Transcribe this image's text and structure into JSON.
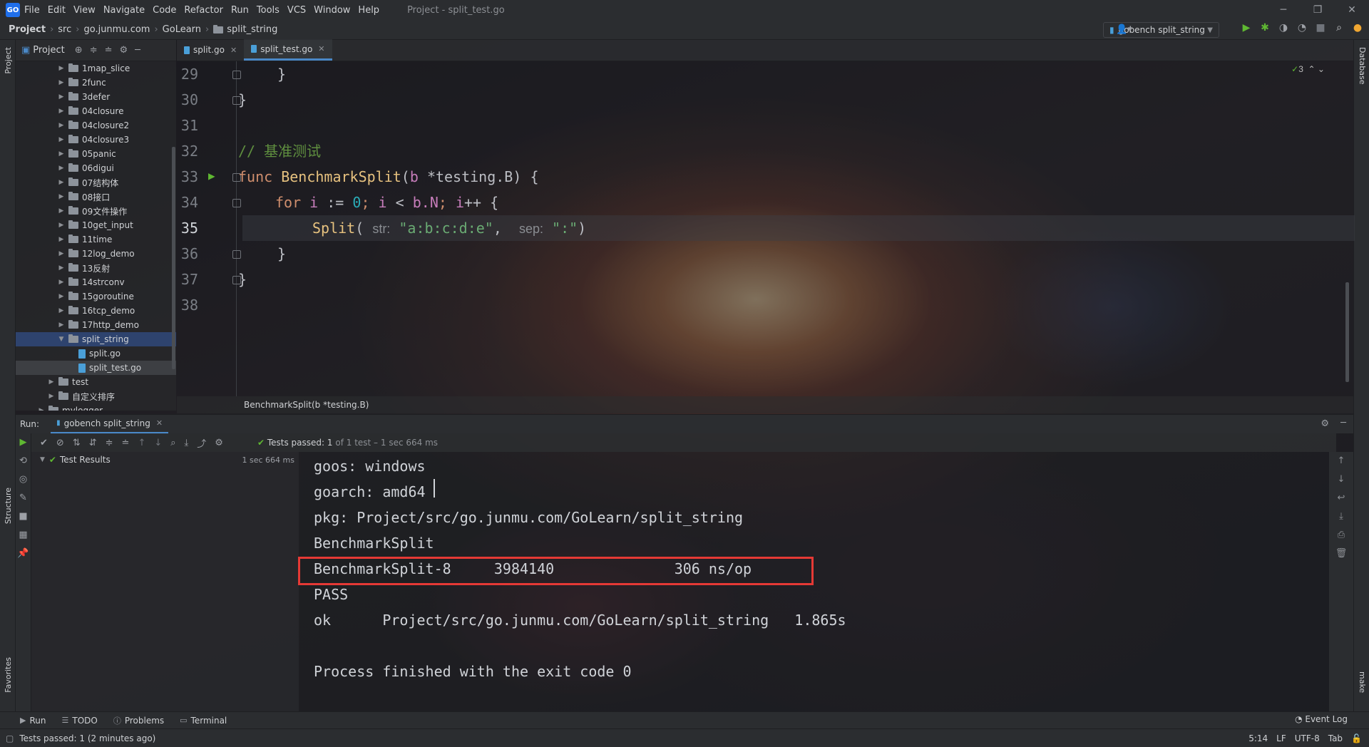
{
  "window": {
    "app_logo": "GO",
    "menu": [
      "File",
      "Edit",
      "View",
      "Navigate",
      "Code",
      "Refactor",
      "Run",
      "Tools",
      "VCS",
      "Window",
      "Help"
    ],
    "title": "Project - split_test.go"
  },
  "nav": {
    "breadcrumbs": [
      "Project",
      "src",
      "go.junmu.com",
      "GoLearn",
      "split_string"
    ],
    "run_config": "gobench split_string"
  },
  "left_stripe": {
    "project": "Project",
    "structure": "Structure",
    "favorites": "Favorites"
  },
  "right_stripe": {
    "database": "Database",
    "make": "make"
  },
  "project_panel": {
    "header": "Project",
    "items": [
      {
        "label": "1map_slice",
        "type": "folder",
        "depth": 4
      },
      {
        "label": "2func",
        "type": "folder",
        "depth": 4
      },
      {
        "label": "3defer",
        "type": "folder",
        "depth": 4
      },
      {
        "label": "04closure",
        "type": "folder",
        "depth": 4
      },
      {
        "label": "04closure2",
        "type": "folder",
        "depth": 4
      },
      {
        "label": "04closure3",
        "type": "folder",
        "depth": 4
      },
      {
        "label": "05panic",
        "type": "folder",
        "depth": 4
      },
      {
        "label": "06digui",
        "type": "folder",
        "depth": 4
      },
      {
        "label": "07结构体",
        "type": "folder",
        "depth": 4
      },
      {
        "label": "08接口",
        "type": "folder",
        "depth": 4
      },
      {
        "label": "09文件操作",
        "type": "folder",
        "depth": 4
      },
      {
        "label": "10get_input",
        "type": "folder",
        "depth": 4
      },
      {
        "label": "11time",
        "type": "folder",
        "depth": 4
      },
      {
        "label": "12log_demo",
        "type": "folder",
        "depth": 4
      },
      {
        "label": "13反射",
        "type": "folder",
        "depth": 4
      },
      {
        "label": "14strconv",
        "type": "folder",
        "depth": 4
      },
      {
        "label": "15goroutine",
        "type": "folder",
        "depth": 4
      },
      {
        "label": "16tcp_demo",
        "type": "folder",
        "depth": 4
      },
      {
        "label": "17http_demo",
        "type": "folder",
        "depth": 4
      },
      {
        "label": "split_string",
        "type": "folder",
        "depth": 4,
        "expanded": true,
        "state": "selected"
      },
      {
        "label": "split.go",
        "type": "file",
        "depth": 5
      },
      {
        "label": "split_test.go",
        "type": "file",
        "depth": 5,
        "state": "current"
      },
      {
        "label": "test",
        "type": "folder",
        "depth": 3
      },
      {
        "label": "自定义排序",
        "type": "folder",
        "depth": 3
      },
      {
        "label": "mylogger",
        "type": "folder",
        "depth": 2
      }
    ]
  },
  "editor": {
    "tabs": [
      {
        "label": "split.go",
        "active": false
      },
      {
        "label": "split_test.go",
        "active": true
      }
    ],
    "inspection_count": "3",
    "line_numbers": [
      "29",
      "30",
      "31",
      "32",
      "33",
      "34",
      "35",
      "36",
      "37",
      "38"
    ],
    "current_line": "35",
    "lines": {
      "l29": "}",
      "l30": "}",
      "l32_comment": "// 基准测试",
      "l33_kw": "func",
      "l33_name": "BenchmarkSplit",
      "l33_params_open": "(",
      "l33_param": "b",
      "l33_type": "*testing.B",
      "l33_close": ") {",
      "l34_for": "for",
      "l34_i1": "i",
      "l34_assign": ":=",
      "l34_zero": "0",
      "l34_semi1": ";",
      "l34_i2": "i",
      "l34_lt": "<",
      "l34_bn": "b.N",
      "l34_semi2": ";",
      "l34_i3": "i",
      "l34_inc": "++ {",
      "l35_call": "Split",
      "l35_open": "(",
      "l35_hint1": "str:",
      "l35_arg1": "\"a:b:c:d:e\"",
      "l35_comma": ",",
      "l35_hint2": "sep:",
      "l35_arg2": "\":\"",
      "l35_close": ")",
      "l36": "}",
      "l37": "}"
    },
    "breadcrumb": "BenchmarkSplit(b *testing.B)"
  },
  "run_panel": {
    "label": "Run:",
    "tab": "gobench split_string",
    "summary_status": "Tests passed:",
    "summary_count": "1",
    "summary_rest": "of 1 test – 1 sec 664 ms",
    "results_label": "Test Results",
    "results_time": "1 sec 664 ms",
    "console_lines": [
      "goos: windows",
      "goarch: amd64",
      "pkg: Project/src/go.junmu.com/GoLearn/split_string",
      "BenchmarkSplit",
      "BenchmarkSplit-8     3984140              306 ns/op",
      "PASS",
      "ok      Project/src/go.junmu.com/GoLearn/split_string   1.865s",
      "",
      "Process finished with the exit code 0"
    ],
    "highlight_color": "#e53935"
  },
  "bottom_tabs": [
    "Run",
    "TODO",
    "Problems",
    "Terminal"
  ],
  "event_log": "Event Log",
  "status": {
    "message": "Tests passed: 1 (2 minutes ago)",
    "position": "5:14",
    "line_sep": "LF",
    "encoding": "UTF-8",
    "indent": "Tab"
  }
}
